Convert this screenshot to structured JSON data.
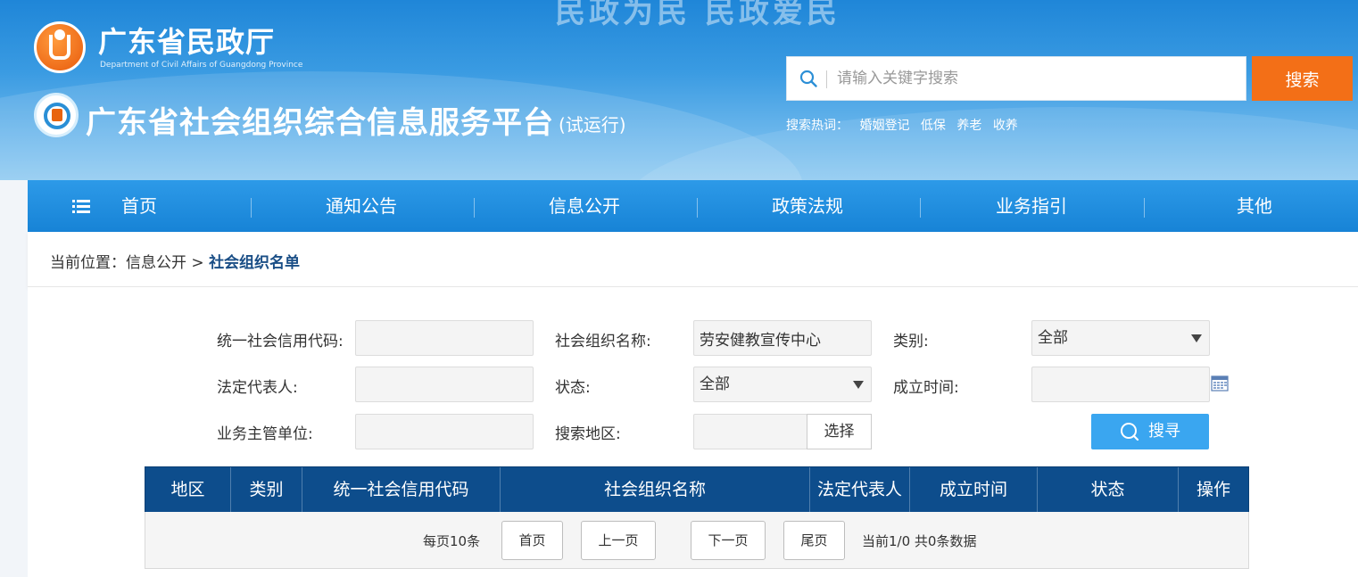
{
  "header": {
    "slogan": "民政为民 民政爱民",
    "dept_name": "广东省民政厅",
    "dept_en": "Department of Civil Affairs of Guangdong Province",
    "platform_title": "广东省社会组织综合信息服务平台",
    "platform_sub": "(试运行)",
    "search": {
      "placeholder": "请输入关键字搜索",
      "button": "搜索",
      "hot_label": "搜索热词：",
      "hot_words": [
        "婚姻登记",
        "低保",
        "养老",
        "收养"
      ]
    }
  },
  "nav": {
    "items": [
      "首页",
      "通知公告",
      "信息公开",
      "政策法规",
      "业务指引",
      "其他"
    ]
  },
  "breadcrumb": {
    "prefix": "当前位置：",
    "parent": "信息公开",
    "separator": " > ",
    "current": "社会组织名单"
  },
  "form": {
    "credit_code_label": "统一社会信用代码:",
    "credit_code_value": "",
    "org_name_label": "社会组织名称:",
    "org_name_value": "劳安健教宣传中心",
    "category_label": "类别:",
    "category_value": "全部",
    "legal_rep_label": "法定代表人:",
    "legal_rep_value": "",
    "status_label": "状态:",
    "status_value": "全部",
    "founded_label": "成立时间:",
    "founded_value": "",
    "supervisor_label": "业务主管单位:",
    "supervisor_value": "",
    "region_label": "搜索地区:",
    "region_value": "",
    "choose_button": "选择",
    "query_button": "搜寻"
  },
  "table": {
    "columns": [
      "地区",
      "类别",
      "统一社会信用代码",
      "社会组织名称",
      "法定代表人",
      "成立时间",
      "状态",
      "操作"
    ],
    "rows": []
  },
  "pagination": {
    "per_page": "每页10条",
    "first": "首页",
    "prev": "上一页",
    "next": "下一页",
    "last": "尾页",
    "info": "当前1/0 共0条数据"
  },
  "colors": {
    "nav_blue": "#1783d6",
    "search_orange": "#f36f17",
    "table_head": "#0d4d8c",
    "query_blue": "#3aa6f0",
    "crumb_current": "#1a4e86"
  }
}
